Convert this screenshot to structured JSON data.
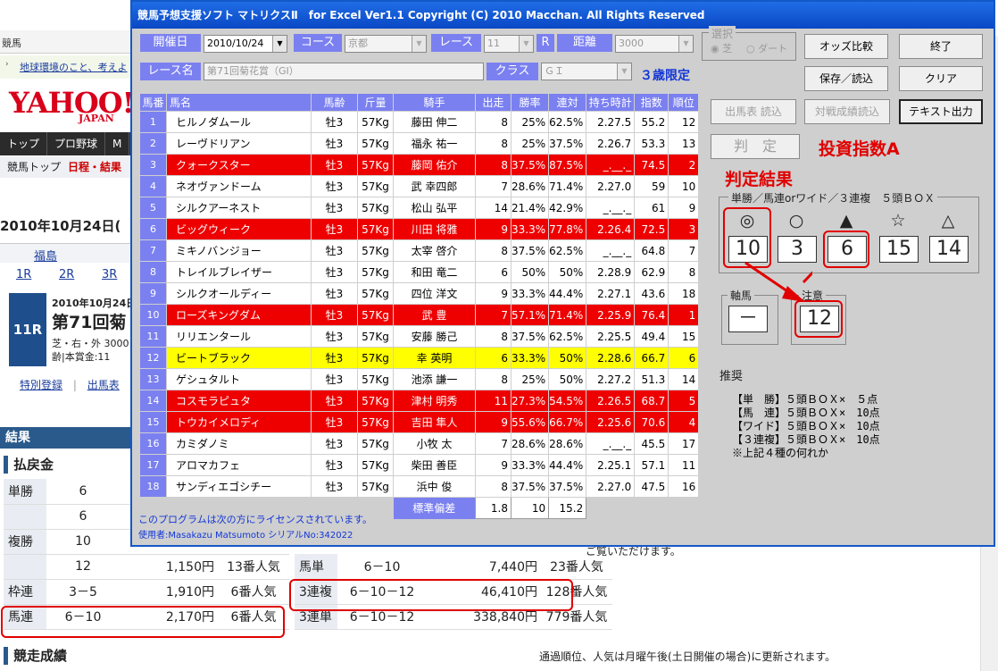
{
  "background": {
    "top_tab": "競馬",
    "ticker_text": "地球環境のこと、考えよ",
    "logo_main": "YAHOO!",
    "logo_sub": "JAPAN",
    "nav": [
      "トップ",
      "プロ野球",
      "M"
    ],
    "subnav": [
      "競馬トップ",
      "日程・結果"
    ],
    "date_header": "2010年10月24日(",
    "venue": "福島",
    "race_links": [
      "1R",
      "2R",
      "3R"
    ],
    "race_badge": "11R",
    "race_date": "2010年10月24日",
    "race_title": "第71回菊",
    "race_info_1": "芝・右・外 3000",
    "race_info_2": "齢|本賞金:11",
    "links_row": [
      "特別登録",
      "出馬表"
    ],
    "result_bar": "結果",
    "payout_title": "払戻金",
    "payout_note": "ご覧いただけます。",
    "payout_left": [
      {
        "type": "単勝",
        "num": "6",
        "yen": "",
        "rank": ""
      },
      {
        "type": "",
        "num": "6",
        "yen": "",
        "rank": ""
      },
      {
        "type": "複勝",
        "num": "10",
        "yen": "",
        "rank": ""
      },
      {
        "type": "",
        "num": "12",
        "yen": "1,150円",
        "rank": "13番人気"
      },
      {
        "type": "枠連",
        "num": "3－5",
        "yen": "1,910円",
        "rank": "6番人気"
      },
      {
        "type": "馬連",
        "num": "6－10",
        "yen": "2,170円",
        "rank": "6番人気"
      }
    ],
    "payout_right": [
      {
        "type": "馬単",
        "num": "6－10",
        "yen": "7,440円",
        "rank": "23番人気"
      },
      {
        "type": "3連複",
        "num": "6－10－12",
        "yen": "46,410円",
        "rank": "128番人気"
      },
      {
        "type": "3連単",
        "num": "6－10－12",
        "yen": "338,840円",
        "rank": "779番人気"
      }
    ],
    "results_title": "競走成績",
    "results_note": "通過順位、人気は月曜午後(土日開催の場合)に更新されます。"
  },
  "dialog": {
    "title": "競馬予想支援ソフト マトリクスⅡ　for Excel Ver1.1 Copyright (C) 2010 Macchan. All Rights Reserved",
    "fields": {
      "date_label": "開催日",
      "date_value": "2010/10/24",
      "course_label": "コース",
      "course_value": "京都",
      "race_label": "レース",
      "race_value": "11",
      "r_label": "R",
      "distance_label": "距離",
      "distance_value": "3000",
      "racename_label": "レース名",
      "racename_value": "第71回菊花賞（GI）",
      "class_label": "クラス",
      "class_value": "ＧＩ",
      "age_limit": "３歳限定"
    },
    "selection": {
      "legend": "選択",
      "turf": "芝",
      "dirt": "ダート"
    },
    "buttons": {
      "odds": "オッズ比較",
      "exit": "終了",
      "save": "保存／読込",
      "clear": "クリア",
      "entries": "出馬表 読込",
      "matchup": "対戦成績読込",
      "text_out": "テキスト出力",
      "judge": "判　定"
    },
    "index_label": "投資指数A",
    "result_title": "判定結果",
    "result_subtitle": "単勝／馬連orワイド／３連複　５頭ＢＯＸ",
    "marks": [
      {
        "symbol": "◎",
        "value": "10"
      },
      {
        "symbol": "○",
        "value": "3"
      },
      {
        "symbol": "▲",
        "value": "6"
      },
      {
        "symbol": "☆",
        "value": "15"
      },
      {
        "symbol": "△",
        "value": "14"
      }
    ],
    "axis_label": "軸馬",
    "axis_value": "－",
    "caution_label": "注意",
    "caution_value": "12",
    "recommend_label": "推奨",
    "recommend_lines": [
      "【単　勝】５頭ＢＯＸ×　５点",
      "【馬　連】５頭ＢＯＸ×　10点",
      "【ワイド】５頭ＢＯＸ×　10点",
      "【３連複】５頭ＢＯＸ×　10点",
      "※上記４種の何れか"
    ],
    "table_headers": [
      "馬番",
      "馬名",
      "馬齢",
      "斤量",
      "騎手",
      "出走",
      "勝率",
      "連対",
      "持ち時計",
      "指数",
      "順位"
    ],
    "horses": [
      {
        "no": "1",
        "name": "ヒルノダムール",
        "age": "牡3",
        "wt": "57Kg",
        "jockey": "藤田 伸二",
        "starts": "8",
        "win": "25%",
        "place": "62.5%",
        "time": "2.27.5",
        "idx": "55.2",
        "rank": "12",
        "hl": ""
      },
      {
        "no": "2",
        "name": "レーヴドリアン",
        "age": "牡3",
        "wt": "57Kg",
        "jockey": "福永 祐一",
        "starts": "8",
        "win": "25%",
        "place": "37.5%",
        "time": "2.26.7",
        "idx": "53.3",
        "rank": "13",
        "hl": ""
      },
      {
        "no": "3",
        "name": "クォークスター",
        "age": "牡3",
        "wt": "57Kg",
        "jockey": "藤岡 佑介",
        "starts": "8",
        "win": "37.5%",
        "place": "87.5%",
        "time": "_.__._",
        "idx": "74.5",
        "rank": "2",
        "hl": "red"
      },
      {
        "no": "4",
        "name": "ネオヴァンドーム",
        "age": "牡3",
        "wt": "57Kg",
        "jockey": "武 幸四郎",
        "starts": "7",
        "win": "28.6%",
        "place": "71.4%",
        "time": "2.27.0",
        "idx": "59",
        "rank": "10",
        "hl": ""
      },
      {
        "no": "5",
        "name": "シルクアーネスト",
        "age": "牡3",
        "wt": "57Kg",
        "jockey": "松山 弘平",
        "starts": "14",
        "win": "21.4%",
        "place": "42.9%",
        "time": "_.__._",
        "idx": "61",
        "rank": "9",
        "hl": ""
      },
      {
        "no": "6",
        "name": "ビッグウィーク",
        "age": "牡3",
        "wt": "57Kg",
        "jockey": "川田 将雅",
        "starts": "9",
        "win": "33.3%",
        "place": "77.8%",
        "time": "2.26.4",
        "idx": "72.5",
        "rank": "3",
        "hl": "red"
      },
      {
        "no": "7",
        "name": "ミキノバンジョー",
        "age": "牡3",
        "wt": "57Kg",
        "jockey": "太宰 啓介",
        "starts": "8",
        "win": "37.5%",
        "place": "62.5%",
        "time": "_.__._",
        "idx": "64.8",
        "rank": "7",
        "hl": ""
      },
      {
        "no": "8",
        "name": "トレイルブレイザー",
        "age": "牡3",
        "wt": "57Kg",
        "jockey": "和田 竜二",
        "starts": "6",
        "win": "50%",
        "place": "50%",
        "time": "2.28.9",
        "idx": "62.9",
        "rank": "8",
        "hl": ""
      },
      {
        "no": "9",
        "name": "シルクオールディー",
        "age": "牡3",
        "wt": "57Kg",
        "jockey": "四位 洋文",
        "starts": "9",
        "win": "33.3%",
        "place": "44.4%",
        "time": "2.27.1",
        "idx": "43.6",
        "rank": "18",
        "hl": ""
      },
      {
        "no": "10",
        "name": "ローズキングダム",
        "age": "牡3",
        "wt": "57Kg",
        "jockey": "武 豊",
        "starts": "7",
        "win": "57.1%",
        "place": "71.4%",
        "time": "2.25.9",
        "idx": "76.4",
        "rank": "1",
        "hl": "red"
      },
      {
        "no": "11",
        "name": "リリエンタール",
        "age": "牡3",
        "wt": "57Kg",
        "jockey": "安藤 勝己",
        "starts": "8",
        "win": "37.5%",
        "place": "62.5%",
        "time": "2.25.5",
        "idx": "49.4",
        "rank": "15",
        "hl": ""
      },
      {
        "no": "12",
        "name": "ビートブラック",
        "age": "牡3",
        "wt": "57Kg",
        "jockey": "幸 英明",
        "starts": "6",
        "win": "33.3%",
        "place": "50%",
        "time": "2.28.6",
        "idx": "66.7",
        "rank": "6",
        "hl": "yellow"
      },
      {
        "no": "13",
        "name": "ゲシュタルト",
        "age": "牡3",
        "wt": "57Kg",
        "jockey": "池添 謙一",
        "starts": "8",
        "win": "25%",
        "place": "50%",
        "time": "2.27.2",
        "idx": "51.3",
        "rank": "14",
        "hl": ""
      },
      {
        "no": "14",
        "name": "コスモラピュタ",
        "age": "牡3",
        "wt": "57Kg",
        "jockey": "津村 明秀",
        "starts": "11",
        "win": "27.3%",
        "place": "54.5%",
        "time": "2.26.5",
        "idx": "68.7",
        "rank": "5",
        "hl": "red"
      },
      {
        "no": "15",
        "name": "トウカイメロディ",
        "age": "牡3",
        "wt": "57Kg",
        "jockey": "吉田 隼人",
        "starts": "9",
        "win": "55.6%",
        "place": "66.7%",
        "time": "2.25.6",
        "idx": "70.6",
        "rank": "4",
        "hl": "red"
      },
      {
        "no": "16",
        "name": "カミダノミ",
        "age": "牡3",
        "wt": "57Kg",
        "jockey": "小牧 太",
        "starts": "7",
        "win": "28.6%",
        "place": "28.6%",
        "time": "_.__._",
        "idx": "45.5",
        "rank": "17",
        "hl": ""
      },
      {
        "no": "17",
        "name": "アロマカフェ",
        "age": "牡3",
        "wt": "57Kg",
        "jockey": "柴田 善臣",
        "starts": "9",
        "win": "33.3%",
        "place": "44.4%",
        "time": "2.25.1",
        "idx": "57.1",
        "rank": "11",
        "hl": ""
      },
      {
        "no": "18",
        "name": "サンディエゴシチー",
        "age": "牡3",
        "wt": "57Kg",
        "jockey": "浜中 俊",
        "starts": "8",
        "win": "37.5%",
        "place": "37.5%",
        "time": "2.27.0",
        "idx": "47.5",
        "rank": "16",
        "hl": ""
      }
    ],
    "std_label": "標準偏差",
    "std_values": [
      "1.8",
      "10",
      "15.2"
    ],
    "license_line1": "このプログラムは次の方にライセンスされています。",
    "license_line2": "使用者:Masakazu Matsumoto シリアルNo:342022"
  }
}
